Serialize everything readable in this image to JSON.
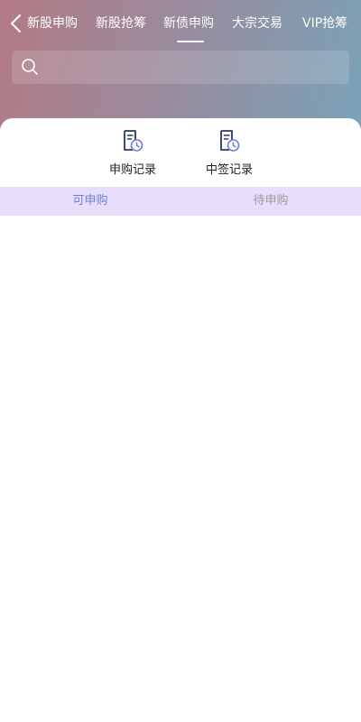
{
  "nav": {
    "tabs": [
      {
        "label": "新股申购"
      },
      {
        "label": "新股抢筹"
      },
      {
        "label": "新债申购"
      },
      {
        "label": "大宗交易"
      },
      {
        "label": "VIP抢筹"
      }
    ],
    "active_tab_index": 2
  },
  "search": {
    "value": "",
    "placeholder": ""
  },
  "quick_actions": [
    {
      "label": "申购记录",
      "icon": "document-clock-icon"
    },
    {
      "label": "中签记录",
      "icon": "document-clock-icon"
    }
  ],
  "subtabs": [
    {
      "label": "可申购",
      "active": true
    },
    {
      "label": "待申购",
      "active": false
    }
  ],
  "colors": {
    "gradient_start": "#b27a84",
    "gradient_end": "#79a2b8",
    "subtab_bg": "#e6defa",
    "subtab_active": "#6f7fd9",
    "subtab_inactive": "#9a9a9a",
    "icon_dark": "#2b3866",
    "icon_accent": "#6f7fd9"
  }
}
